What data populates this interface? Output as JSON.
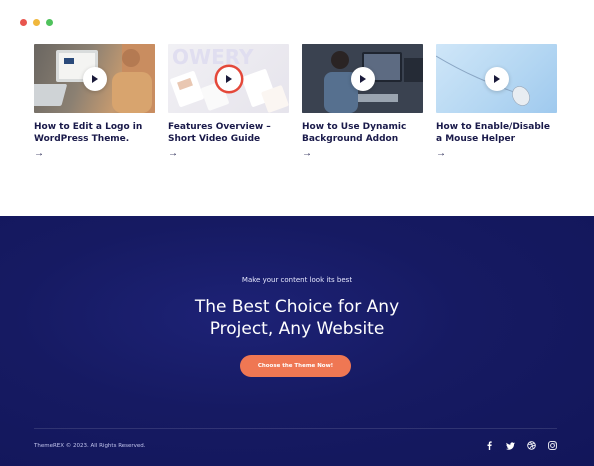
{
  "window": {
    "dots": [
      {
        "name": "close-dot",
        "color": "#e8554e"
      },
      {
        "name": "minimize-dot",
        "color": "#f0b73c"
      },
      {
        "name": "maximize-dot",
        "color": "#4fc25c"
      }
    ]
  },
  "cards": [
    {
      "title": "How to Edit a Logo in WordPress Theme.",
      "arrow": "→"
    },
    {
      "title": "Features Overview – Short Video Guide",
      "arrow": "→"
    },
    {
      "title": "How to Use Dynamic Background Addon",
      "arrow": "→"
    },
    {
      "title": "How to Enable/Disable a Mouse Helper",
      "arrow": "→"
    }
  ],
  "cta_section": {
    "eyebrow": "Make your content look its best",
    "headline_line1": "The Best Choice for Any",
    "headline_line2": "Project, Any Website",
    "button_label": "Choose the Theme Now!"
  },
  "footer": {
    "copyright": "ThemeREX © 2023. All Rights Reserved.",
    "social_icons": [
      "facebook-icon",
      "twitter-icon",
      "dribbble-icon",
      "instagram-icon"
    ]
  },
  "colors": {
    "accent": "#ef7753",
    "footer_bg": "#161a62",
    "title_text": "#1a1a4a"
  }
}
